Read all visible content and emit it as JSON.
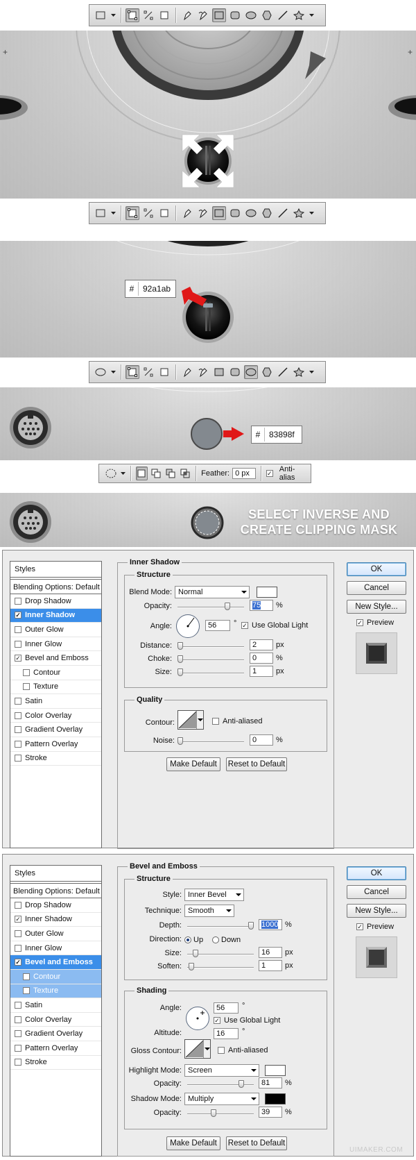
{
  "steps": [
    {
      "hex": ""
    },
    {
      "hex": "92a1ab"
    },
    {
      "hex": "83898f"
    },
    {
      "feather_label": "Feather:",
      "feather_value": "0 px",
      "antialias_label": "Anti-alias",
      "caption_line1": "SELECT INVERSE AND",
      "caption_line2": "CREATE CLIPPING MASK"
    }
  ],
  "hash": "#",
  "colors": {
    "arrow_white": "#ffffff",
    "arrow_red": "#e01818",
    "fill_1": "#92a1ab",
    "fill_2": "#83898f",
    "accent": "#3b8ee9"
  },
  "dialog1": {
    "styles_header": "Styles",
    "blend_options": "Blending Options: Default",
    "items": [
      {
        "label": "Drop Shadow",
        "checked": false
      },
      {
        "label": "Inner Shadow",
        "checked": true
      },
      {
        "label": "Outer Glow",
        "checked": false
      },
      {
        "label": "Inner Glow",
        "checked": false
      },
      {
        "label": "Bevel and Emboss",
        "checked": true
      },
      {
        "label": "Contour",
        "checked": false
      },
      {
        "label": "Texture",
        "checked": false
      },
      {
        "label": "Satin",
        "checked": false
      },
      {
        "label": "Color Overlay",
        "checked": false
      },
      {
        "label": "Gradient Overlay",
        "checked": false
      },
      {
        "label": "Pattern Overlay",
        "checked": false
      },
      {
        "label": "Stroke",
        "checked": false
      }
    ],
    "section_title": "Inner Shadow",
    "structure_title": "Structure",
    "blend_mode_label": "Blend Mode:",
    "blend_mode_value": "Normal",
    "opacity_label": "Opacity:",
    "opacity_value": "75",
    "angle_label": "Angle:",
    "angle_value": "56",
    "degree": "°",
    "use_global_light": "Use Global Light",
    "distance_label": "Distance:",
    "distance_value": "2",
    "choke_label": "Choke:",
    "choke_value": "0",
    "size_label": "Size:",
    "size_value": "1",
    "px": "px",
    "pct": "%",
    "quality_title": "Quality",
    "contour_label": "Contour:",
    "anti_aliased": "Anti-aliased",
    "noise_label": "Noise:",
    "noise_value": "0",
    "make_default": "Make Default",
    "reset_default": "Reset to Default",
    "ok": "OK",
    "cancel": "Cancel",
    "new_style": "New Style...",
    "preview": "Preview"
  },
  "dialog2": {
    "styles_header": "Styles",
    "blend_options": "Blending Options: Default",
    "items": [
      {
        "label": "Drop Shadow",
        "checked": false
      },
      {
        "label": "Inner Shadow",
        "checked": true
      },
      {
        "label": "Outer Glow",
        "checked": false
      },
      {
        "label": "Inner Glow",
        "checked": false
      },
      {
        "label": "Bevel and Emboss",
        "checked": true
      },
      {
        "label": "Contour",
        "checked": false
      },
      {
        "label": "Texture",
        "checked": false
      },
      {
        "label": "Satin",
        "checked": false
      },
      {
        "label": "Color Overlay",
        "checked": false
      },
      {
        "label": "Gradient Overlay",
        "checked": false
      },
      {
        "label": "Pattern Overlay",
        "checked": false
      },
      {
        "label": "Stroke",
        "checked": false
      }
    ],
    "section_title": "Bevel and Emboss",
    "structure_title": "Structure",
    "style_label": "Style:",
    "style_value": "Inner Bevel",
    "technique_label": "Technique:",
    "technique_value": "Smooth",
    "depth_label": "Depth:",
    "depth_value": "1000",
    "direction_label": "Direction:",
    "up": "Up",
    "down": "Down",
    "size_label": "Size:",
    "size_value": "16",
    "soften_label": "Soften:",
    "soften_value": "1",
    "shading_title": "Shading",
    "angle_label": "Angle:",
    "angle_value": "56",
    "use_global_light": "Use Global Light",
    "altitude_label": "Altitude:",
    "altitude_value": "16",
    "degree": "°",
    "gloss_contour_label": "Gloss Contour:",
    "anti_aliased": "Anti-aliased",
    "highlight_mode_label": "Highlight Mode:",
    "highlight_mode_value": "Screen",
    "opacity_label": "Opacity:",
    "highlight_opacity": "81",
    "shadow_mode_label": "Shadow Mode:",
    "shadow_mode_value": "Multiply",
    "shadow_opacity": "39",
    "px": "px",
    "pct": "%",
    "make_default": "Make Default",
    "reset_default": "Reset to Default",
    "ok": "OK",
    "cancel": "Cancel",
    "new_style": "New Style...",
    "preview": "Preview"
  },
  "watermark": "UIMAKER.COM"
}
